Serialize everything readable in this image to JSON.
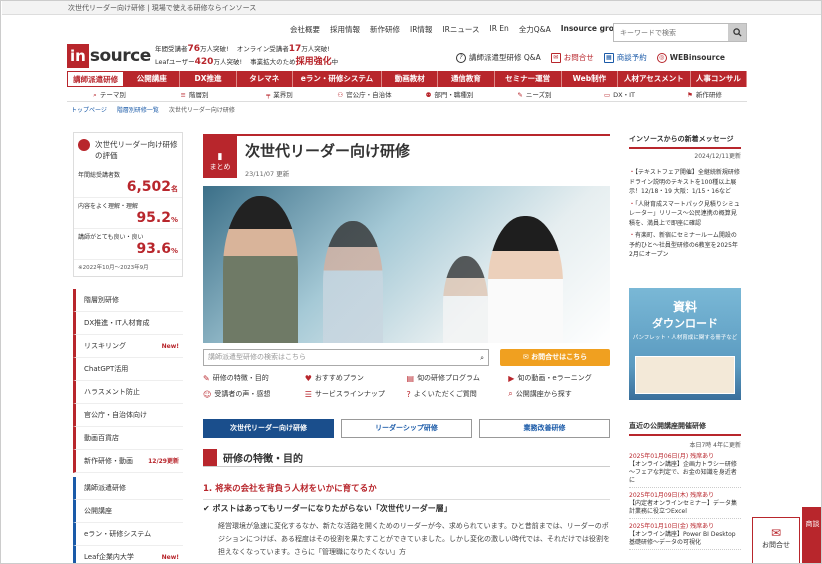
{
  "topbar": {
    "text": "次世代リーダー向け研修 | 現場で使える研修ならインソース"
  },
  "header": {
    "links": [
      "会社概要",
      "採用情報",
      "新作研修",
      "IR情報",
      "IRニュース",
      "IR En",
      "全力Q&A",
      "Insource group"
    ],
    "search_placeholder": "キーワードで検索",
    "logo_in": "in",
    "logo_source": "source",
    "stats_line1_prefix": "年間受講者",
    "stats_line1_value": "76",
    "stats_line1_suffix": "万人突破!",
    "stats_line1b_prefix": "オンライン受講者",
    "stats_line1b_value": "17",
    "stats_line1b_suffix": "万人突破!",
    "stats_line2_prefix": "Leafユーザー",
    "stats_line2_value": "420",
    "stats_line2_suffix": "万人突破!",
    "stats_line2b_prefix": "事業拡大のため",
    "stats_line2b_value": "採用強化",
    "stats_line2b_suffix": "中",
    "buttons": [
      "講師派遣型研修 Q&A",
      "お問合せ",
      "商談予約",
      "WEBinsource"
    ]
  },
  "nav": {
    "items": [
      "講師派遣研修",
      "公開講座",
      "DX推進",
      "タレマネ",
      "eラン・研修システム",
      "動画教材",
      "通信教育",
      "セミナー運営",
      "Web制作",
      "人材アセスメント",
      "人事コンサル"
    ],
    "sub": [
      "テーマ別",
      "階層別",
      "業界別",
      "官公庁・自治体",
      "部門・職種別",
      "ニーズ別",
      "DX・IT",
      "新作研修"
    ]
  },
  "breadcrumb": [
    "トップページ",
    "階層別研修一覧",
    "次世代リーダー向け研修"
  ],
  "sidebar": {
    "eval_title": "次世代リーダー向け研修の評価",
    "stats": [
      {
        "label": "年間総受講者数",
        "value": "6,502",
        "unit": "名"
      },
      {
        "label": "内容をよく理解・理解",
        "value": "95.2",
        "unit": "%"
      },
      {
        "label": "講師がとても良い・良い",
        "value": "93.6",
        "unit": "%"
      }
    ],
    "note": "※2022年10月～2023年9月",
    "menu1": [
      {
        "label": "階層別研修",
        "badge": ""
      },
      {
        "label": "DX推進・IT人材育成",
        "badge": ""
      },
      {
        "label": "リスキリング",
        "badge": "New!"
      },
      {
        "label": "ChatGPT活用",
        "badge": ""
      },
      {
        "label": "ハラスメント防止",
        "badge": ""
      },
      {
        "label": "官公庁・自治体向け",
        "badge": ""
      },
      {
        "label": "動画百貨店",
        "badge": ""
      },
      {
        "label": "新作研修・動画",
        "badge": "12/29更新"
      }
    ],
    "menu2": [
      {
        "label": "講師派遣研修",
        "badge": ""
      },
      {
        "label": "公開講座",
        "badge": ""
      },
      {
        "label": "eラン・研修システム",
        "badge": ""
      },
      {
        "label": "Leaf企業内大学",
        "badge": "New!"
      }
    ]
  },
  "main": {
    "badge": "まとめ",
    "title": "次世代リーダー向け研修",
    "date": "23/11/07 更新",
    "search_placeholder": "講師派遣型研修の検索はこちら",
    "contact": "お問合せはこちら",
    "quick_links": [
      "研修の特徴・目的",
      "おすすめプラン",
      "旬の研修プログラム",
      "旬の動画・eラーニング",
      "受講者の声・感想",
      "サービスラインナップ",
      "よくいただくご質問",
      "公開講座から探す"
    ],
    "tabs": [
      "次世代リーダー向け研修",
      "リーダーシップ研修",
      "業務改善研修"
    ],
    "section": "研修の特徴・目的",
    "heading": "1. 将来の会社を背負う人材をいかに育てるか",
    "point": "ポストはあってもリーダーになりたがらない「次世代リーダー層」",
    "body": "経営環境が急速に変化するなか、新たな活路を開くためのリーダーが今、求められています。ひと昔前までは、リーダーのポジションにつけば、ある程度はその役割を果たすことができていました。しかし変化の激しい時代では、それだけでは役割を担えなくなっています。さらに「管理職になりたくない」方"
  },
  "right": {
    "msg_title": "インソースからの新着メッセージ",
    "msg_date": "2024/12/11更新",
    "news": [
      "【テキストフェア開催】全継続新規研修ドライン説明のテキストを100種以上展示！12/18・19 大阪：1/15・16など",
      "「人財育成スマートパック見積りシミュレーター」リリース～公民連携の概算見積を、満員上で即座に確認",
      "有楽町、新宿にセミナールーム開設の予約ひと～社員型研修の6教室を2025年2月にオープン"
    ],
    "banner_l1": "資料",
    "banner_l2": "ダウンロード",
    "banner_l3": "パンフレット・人材育成に関する冊子など",
    "sched_title": "直近の公開講座開催研修",
    "sched_note": "本日7時 4年に更新",
    "sched": [
      {
        "date": "2025年01月06日(月) 残席あり",
        "text": "【オンライン講座】企画力トラシー研修～フェアな判定で、お金の知識を身近者に"
      },
      {
        "date": "2025年01月09日(木) 残席あり",
        "text": "【内定者オンラインセミナー】データ集計業務に役立つExcel"
      },
      {
        "date": "2025年01月10日(金) 残席あり",
        "text": "【オンライン講座】Power BI Desktop基礎研修～データの可視化"
      }
    ]
  },
  "floating": {
    "contact": "お問合せ",
    "other": "商談"
  }
}
